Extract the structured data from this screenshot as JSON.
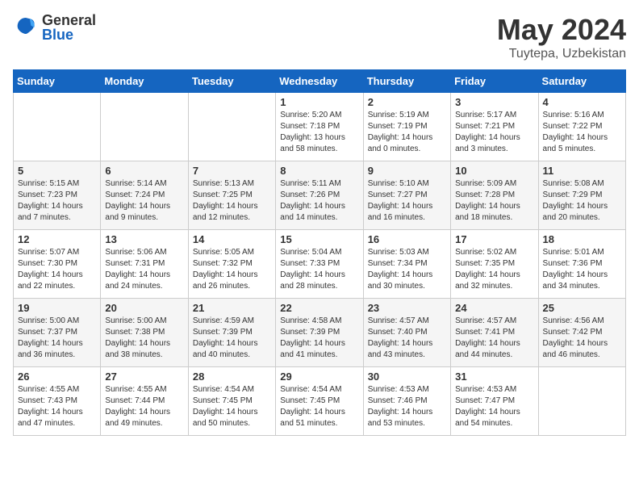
{
  "logo": {
    "general": "General",
    "blue": "Blue"
  },
  "title": "May 2024",
  "location": "Tuytepa, Uzbekistan",
  "days_of_week": [
    "Sunday",
    "Monday",
    "Tuesday",
    "Wednesday",
    "Thursday",
    "Friday",
    "Saturday"
  ],
  "weeks": [
    [
      {
        "day": "",
        "info": ""
      },
      {
        "day": "",
        "info": ""
      },
      {
        "day": "",
        "info": ""
      },
      {
        "day": "1",
        "info": "Sunrise: 5:20 AM\nSunset: 7:18 PM\nDaylight: 13 hours\nand 58 minutes."
      },
      {
        "day": "2",
        "info": "Sunrise: 5:19 AM\nSunset: 7:19 PM\nDaylight: 14 hours\nand 0 minutes."
      },
      {
        "day": "3",
        "info": "Sunrise: 5:17 AM\nSunset: 7:21 PM\nDaylight: 14 hours\nand 3 minutes."
      },
      {
        "day": "4",
        "info": "Sunrise: 5:16 AM\nSunset: 7:22 PM\nDaylight: 14 hours\nand 5 minutes."
      }
    ],
    [
      {
        "day": "5",
        "info": "Sunrise: 5:15 AM\nSunset: 7:23 PM\nDaylight: 14 hours\nand 7 minutes."
      },
      {
        "day": "6",
        "info": "Sunrise: 5:14 AM\nSunset: 7:24 PM\nDaylight: 14 hours\nand 9 minutes."
      },
      {
        "day": "7",
        "info": "Sunrise: 5:13 AM\nSunset: 7:25 PM\nDaylight: 14 hours\nand 12 minutes."
      },
      {
        "day": "8",
        "info": "Sunrise: 5:11 AM\nSunset: 7:26 PM\nDaylight: 14 hours\nand 14 minutes."
      },
      {
        "day": "9",
        "info": "Sunrise: 5:10 AM\nSunset: 7:27 PM\nDaylight: 14 hours\nand 16 minutes."
      },
      {
        "day": "10",
        "info": "Sunrise: 5:09 AM\nSunset: 7:28 PM\nDaylight: 14 hours\nand 18 minutes."
      },
      {
        "day": "11",
        "info": "Sunrise: 5:08 AM\nSunset: 7:29 PM\nDaylight: 14 hours\nand 20 minutes."
      }
    ],
    [
      {
        "day": "12",
        "info": "Sunrise: 5:07 AM\nSunset: 7:30 PM\nDaylight: 14 hours\nand 22 minutes."
      },
      {
        "day": "13",
        "info": "Sunrise: 5:06 AM\nSunset: 7:31 PM\nDaylight: 14 hours\nand 24 minutes."
      },
      {
        "day": "14",
        "info": "Sunrise: 5:05 AM\nSunset: 7:32 PM\nDaylight: 14 hours\nand 26 minutes."
      },
      {
        "day": "15",
        "info": "Sunrise: 5:04 AM\nSunset: 7:33 PM\nDaylight: 14 hours\nand 28 minutes."
      },
      {
        "day": "16",
        "info": "Sunrise: 5:03 AM\nSunset: 7:34 PM\nDaylight: 14 hours\nand 30 minutes."
      },
      {
        "day": "17",
        "info": "Sunrise: 5:02 AM\nSunset: 7:35 PM\nDaylight: 14 hours\nand 32 minutes."
      },
      {
        "day": "18",
        "info": "Sunrise: 5:01 AM\nSunset: 7:36 PM\nDaylight: 14 hours\nand 34 minutes."
      }
    ],
    [
      {
        "day": "19",
        "info": "Sunrise: 5:00 AM\nSunset: 7:37 PM\nDaylight: 14 hours\nand 36 minutes."
      },
      {
        "day": "20",
        "info": "Sunrise: 5:00 AM\nSunset: 7:38 PM\nDaylight: 14 hours\nand 38 minutes."
      },
      {
        "day": "21",
        "info": "Sunrise: 4:59 AM\nSunset: 7:39 PM\nDaylight: 14 hours\nand 40 minutes."
      },
      {
        "day": "22",
        "info": "Sunrise: 4:58 AM\nSunset: 7:39 PM\nDaylight: 14 hours\nand 41 minutes."
      },
      {
        "day": "23",
        "info": "Sunrise: 4:57 AM\nSunset: 7:40 PM\nDaylight: 14 hours\nand 43 minutes."
      },
      {
        "day": "24",
        "info": "Sunrise: 4:57 AM\nSunset: 7:41 PM\nDaylight: 14 hours\nand 44 minutes."
      },
      {
        "day": "25",
        "info": "Sunrise: 4:56 AM\nSunset: 7:42 PM\nDaylight: 14 hours\nand 46 minutes."
      }
    ],
    [
      {
        "day": "26",
        "info": "Sunrise: 4:55 AM\nSunset: 7:43 PM\nDaylight: 14 hours\nand 47 minutes."
      },
      {
        "day": "27",
        "info": "Sunrise: 4:55 AM\nSunset: 7:44 PM\nDaylight: 14 hours\nand 49 minutes."
      },
      {
        "day": "28",
        "info": "Sunrise: 4:54 AM\nSunset: 7:45 PM\nDaylight: 14 hours\nand 50 minutes."
      },
      {
        "day": "29",
        "info": "Sunrise: 4:54 AM\nSunset: 7:45 PM\nDaylight: 14 hours\nand 51 minutes."
      },
      {
        "day": "30",
        "info": "Sunrise: 4:53 AM\nSunset: 7:46 PM\nDaylight: 14 hours\nand 53 minutes."
      },
      {
        "day": "31",
        "info": "Sunrise: 4:53 AM\nSunset: 7:47 PM\nDaylight: 14 hours\nand 54 minutes."
      },
      {
        "day": "",
        "info": ""
      }
    ]
  ]
}
